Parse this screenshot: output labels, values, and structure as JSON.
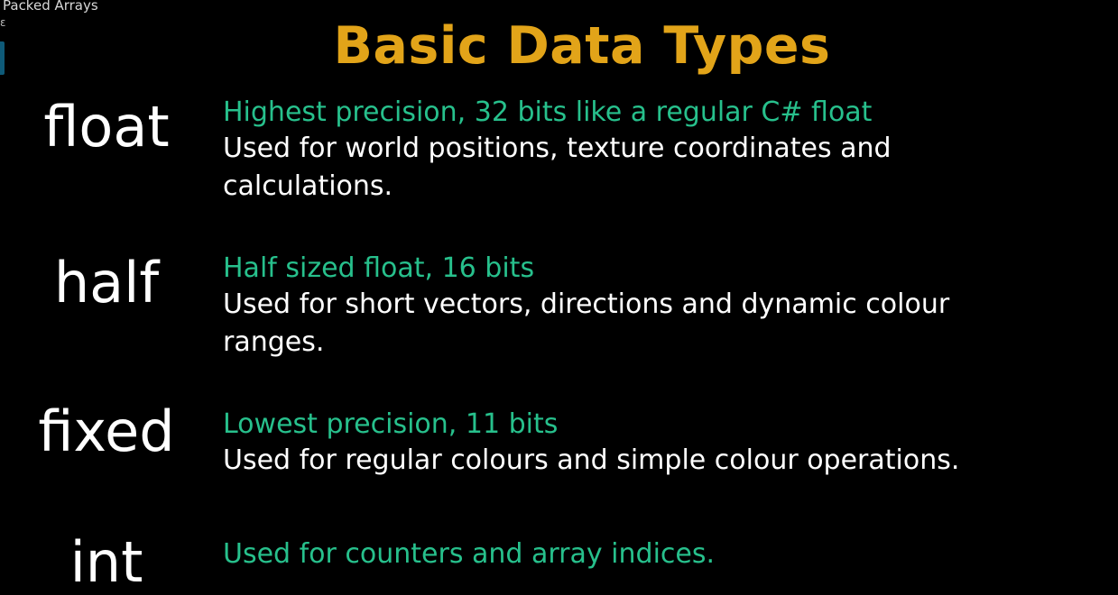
{
  "window": {
    "title": "Packed Arrays",
    "mark": "ɛ"
  },
  "colors": {
    "title": "#e2a419",
    "headline": "#27c08c",
    "body": "#ffffff",
    "background": "#000000",
    "tab": "#0e5a78"
  },
  "slide": {
    "title": "Basic Data Types",
    "types": [
      {
        "name": "float",
        "headline": "Highest precision, 32 bits like a regular C# float",
        "lines": [
          "Used for world positions, texture coordinates and",
          "calculations."
        ]
      },
      {
        "name": "half",
        "headline": "Half sized float, 16 bits",
        "lines": [
          "Used for short vectors, directions and dynamic colour",
          "ranges."
        ]
      },
      {
        "name": "fixed",
        "headline": "Lowest precision, 11 bits",
        "lines": [
          "Used for regular colours and simple colour operations."
        ]
      },
      {
        "name": "int",
        "headline": "Used for counters and array indices.",
        "lines": []
      }
    ]
  }
}
